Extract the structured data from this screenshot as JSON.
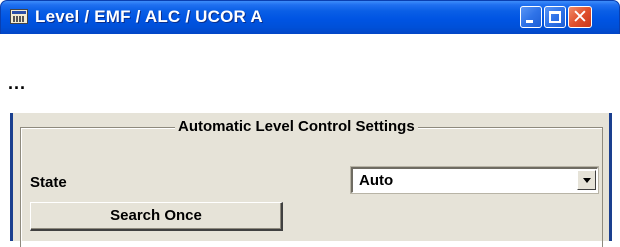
{
  "window": {
    "title": "Level / EMF / ALC / UCOR  A",
    "icon": "app-window-icon",
    "controls": {
      "minimize_icon": "minimize-icon",
      "maximize_icon": "maximize-icon",
      "close_icon": "close-icon",
      "close_glyph": "✕"
    },
    "titlebar_color": "#0054e3",
    "close_color": "#e0512d"
  },
  "ellipsis": "...",
  "alc_group": {
    "title": "Automatic Level Control Settings",
    "state_label": "State",
    "state_value": "Auto",
    "search_once_label": "Search Once"
  },
  "colors": {
    "panel_background": "#e6e3d8",
    "panel_side_border": "#1a3f8f"
  }
}
